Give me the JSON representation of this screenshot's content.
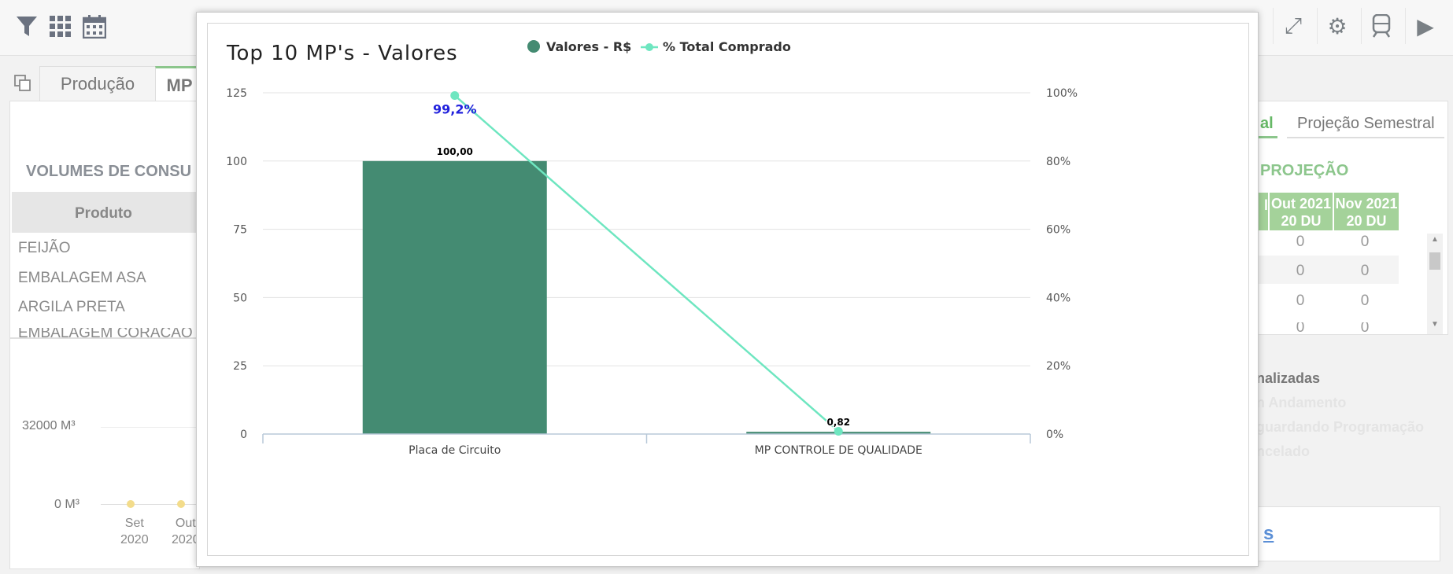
{
  "toolbar": {
    "left_icons": [
      "filter-icon",
      "grid-icon",
      "calendar-icon"
    ],
    "right_icons": [
      "expand-icon",
      "gear-icon",
      "train-icon",
      "play-icon"
    ]
  },
  "tabs": [
    {
      "label": "Produção"
    },
    {
      "label": "MP"
    }
  ],
  "left_panel": {
    "title": "VOLUMES DE CONSU",
    "column_header": "Produto",
    "rows": [
      "FEIJÃO",
      "EMBALAGEM ASA",
      "ARGILA PRETA",
      "EMBALAGEM CORAÇÃO"
    ]
  },
  "mini_chart": {
    "y_labels": [
      "32000 M³",
      "0 M³"
    ],
    "x_labels": [
      [
        "Set",
        "2020"
      ],
      [
        "Out",
        "2020"
      ]
    ]
  },
  "right_panel": {
    "tab_active": "al",
    "tab_other": "Projeção Semestral",
    "section_title": "PROJEÇÃO",
    "col_partial": "l",
    "columns": [
      [
        "Out 2021",
        "20 DU"
      ],
      [
        "Nov 2021",
        "20 DU"
      ]
    ],
    "rows": [
      [
        "0",
        "0"
      ],
      [
        "0",
        "0"
      ],
      [
        "0",
        "0"
      ],
      [
        "0",
        "0"
      ]
    ],
    "legend": [
      "nalizadas",
      "n Andamento",
      "guardando Programação",
      "ncelado"
    ],
    "link_fragment": "s"
  },
  "chart_data": {
    "type": "bar",
    "title": "Top 10 MP's - Valores",
    "categories": [
      "Placa de Circuito",
      "MP CONTROLE DE QUALIDADE"
    ],
    "series": [
      {
        "name": "Valores - R$",
        "kind": "bar",
        "values": [
          100.0,
          0.82
        ],
        "labels": [
          "100,00",
          "0,82"
        ],
        "color": "#448b72"
      },
      {
        "name": "% Total Comprado",
        "kind": "line",
        "axis": "right",
        "values": [
          99.2,
          0.8
        ],
        "labels": [
          "99,2%",
          ""
        ],
        "color": "#6ee6c0"
      }
    ],
    "y_left": {
      "min": 0,
      "max": 125,
      "ticks": [
        "0",
        "25",
        "50",
        "75",
        "100",
        "125"
      ]
    },
    "y_right": {
      "min": 0,
      "max": 100,
      "ticks": [
        "0%",
        "20%",
        "40%",
        "60%",
        "80%",
        "100%"
      ]
    },
    "grid": true,
    "legend_position": "top-center"
  }
}
